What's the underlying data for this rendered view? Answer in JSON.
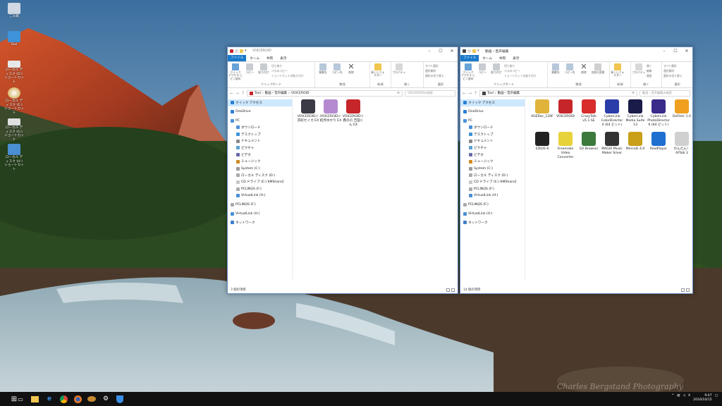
{
  "desktop": {
    "icons": [
      {
        "label": "ごみ箱",
        "color": "#cfd8e3"
      },
      {
        "label": "Tool",
        "color": "#3f93d8"
      },
      {
        "label": "ローカル ディスク (D:) ショートカット",
        "color": "#e8e8e8"
      },
      {
        "label": "ローカル ディスク (E:) ショートカット",
        "color": "#d8d8d8"
      },
      {
        "label": "ローカル ディスク (G:) ショートカット",
        "color": "#e0e0e0"
      },
      {
        "label": "ローカル ディスク (H:) ショートカット",
        "color": "#4a8fd4"
      }
    ]
  },
  "left": {
    "title": "VOICEROID",
    "tabs": [
      "ファイル",
      "ホーム",
      "共有",
      "表示"
    ],
    "groups": {
      "clipboard": "クリップボード",
      "organize": "整理",
      "new": "新規",
      "open": "開く",
      "select": "選択"
    },
    "buttons": {
      "pin": "クイック アクセス にピン留め",
      "copy": "コピー",
      "paste": "貼り付け",
      "cut": "切り取り",
      "copy_path": "パスのコピー",
      "paste_shortcut": "ショートカットの貼り付け",
      "move_to": "移動先",
      "copy_to": "コピー先",
      "delete": "削除",
      "rename": "名前の変更",
      "new_folder": "新しいフォルダー",
      "properties": "プロパティ",
      "open": "開く",
      "edit": "編集",
      "history": "履歴",
      "select_all": "すべて選択",
      "select_none": "選択解除",
      "invert": "選択の切り替え"
    },
    "path": [
      "Tool",
      "動画・音声編集",
      "VOICEROID"
    ],
    "search": "VOICEROIDの検索",
    "files": [
      {
        "label": "VOICEROID＋ 京町セイカ EX",
        "color": "#3b3b45"
      },
      {
        "label": "VOICEROID＋ 結月ゆかり EX",
        "color": "#b58ad0"
      },
      {
        "label": "VOICEROID＋ 鷹の爪 吉田くん EX",
        "color": "#c6262a"
      }
    ],
    "status": "3 個の項目"
  },
  "right": {
    "title": "動画・音声編集",
    "tabs": [
      "ファイル",
      "ホーム",
      "共有",
      "表示"
    ],
    "groups": {
      "clipboard": "クリップボード",
      "organize": "整理",
      "new": "新規",
      "open": "開く",
      "select": "選択"
    },
    "buttons": {
      "pin": "クイック アクセス にピン留め",
      "copy": "コピー",
      "paste": "貼り付け",
      "cut": "切り取り",
      "copy_path": "パスのコピー",
      "paste_shortcut": "ショートカットの貼り付け",
      "move_to": "移動先",
      "copy_to": "コピー先",
      "delete": "削除",
      "rename": "名前の変更",
      "new_folder": "新しいフォルダー",
      "properties": "プロパティ",
      "open": "開く",
      "edit": "編集",
      "history": "履歴",
      "select_all": "すべて選択",
      "select_none": "選択解除",
      "invert": "選択の切り替え"
    },
    "path": [
      "Tool",
      "動画・音声編集"
    ],
    "search": "動画・音声編集の検索",
    "files": [
      {
        "label": "AGERec_130F",
        "color": "#e0b33a"
      },
      {
        "label": "VOICEROID",
        "color": "#c6262a"
      },
      {
        "label": "CrazyTalk v5.1 SE",
        "color": "#d82c2c"
      },
      {
        "label": "CyberLink ColorDirector 4 (64 ビット)",
        "color": "#2a3da8"
      },
      {
        "label": "CyberLink Media Suite 13",
        "color": "#1b1b4a"
      },
      {
        "label": "CyberLink PhotoDirector 6 (64 ビット)",
        "color": "#3a2a8a"
      },
      {
        "label": "DeFishr 1.0",
        "color": "#f0a020"
      },
      {
        "label": "EDIUS 8",
        "color": "#222222"
      },
      {
        "label": "Freemake Video Converter",
        "color": "#e8d23a"
      },
      {
        "label": "GV Browser",
        "color": "#3b7a3b"
      },
      {
        "label": "MAGIX Music Maker Silver",
        "color": "#333333"
      },
      {
        "label": "Mercalli 4.0",
        "color": "#c9a018"
      },
      {
        "label": "RealPlayer",
        "color": "#1e6fd0"
      },
      {
        "label": "かんたん！AITalk 3",
        "color": "#d0d0d0"
      }
    ],
    "status": "14 個の項目"
  },
  "nav": [
    {
      "label": "クイック アクセス",
      "c": "#2a7fd4",
      "sel": true,
      "ind": 0
    },
    {
      "label": "OneDrive",
      "c": "#2a7fd4",
      "ind": 0,
      "gap": 1
    },
    {
      "label": "PC",
      "c": "#4a90d9",
      "ind": 0,
      "gap": 1
    },
    {
      "label": "ダウンロード",
      "c": "#4a90d9",
      "ind": 1
    },
    {
      "label": "デスクトップ",
      "c": "#3f93d8",
      "ind": 1
    },
    {
      "label": "ドキュメント",
      "c": "#888888",
      "ind": 1
    },
    {
      "label": "ピクチャ",
      "c": "#5aa0d0",
      "ind": 1
    },
    {
      "label": "ビデオ",
      "c": "#6a6aaa",
      "ind": 1
    },
    {
      "label": "ミュージック",
      "c": "#d08a20",
      "ind": 1
    },
    {
      "label": "System (C:)",
      "c": "#999999",
      "ind": 1
    },
    {
      "label": "ローカル ディスク (D:)",
      "c": "#aaaaaa",
      "ind": 1
    },
    {
      "label": "CD ドライブ (E:) KMShare2",
      "c": "#c8c8c8",
      "ind": 1
    },
    {
      "label": "PCLINQS (F:)",
      "c": "#aaaaaa",
      "ind": 1
    },
    {
      "label": "VirtualLink (H:)",
      "c": "#4a8fd4",
      "ind": 1
    },
    {
      "label": "PCLINQS (F:)",
      "c": "#aaaaaa",
      "ind": 0,
      "gap": 1
    },
    {
      "label": "VirtualLink (H:)",
      "c": "#4a8fd4",
      "ind": 0,
      "gap": 1
    },
    {
      "label": "ネットワーク",
      "c": "#3f7fc8",
      "ind": 0,
      "gap": 1
    }
  ],
  "tray": {
    "time": "9:47",
    "date": "2016/10/15",
    "ime": "A"
  },
  "watermark": "Charles Bergstand Photography"
}
